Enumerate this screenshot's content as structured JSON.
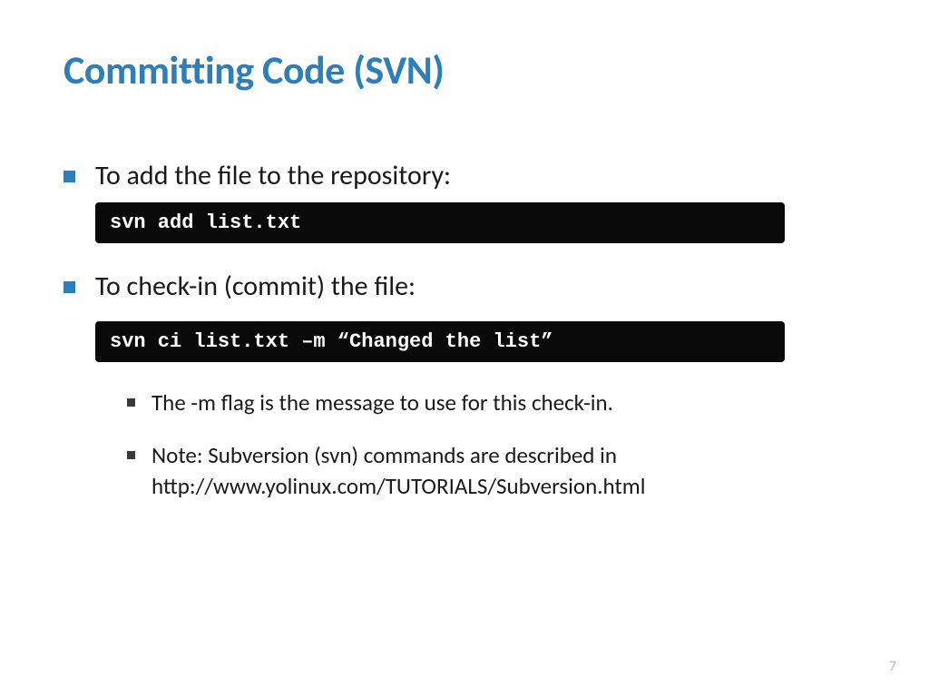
{
  "title": "Committing Code (SVN)",
  "bullets": [
    {
      "text": "To add the file to the repository:",
      "code": "svn add list.txt"
    },
    {
      "text": "To check-in (commit) the file:",
      "code": "svn ci list.txt –m “Changed the list”"
    }
  ],
  "sub_bullets": [
    "The -m flag is the message to use for this check-in.",
    "Note: Subversion (svn) commands are described in http://www.yolinux.com/TUTORIALS/Subversion.html"
  ],
  "page_number": "7"
}
